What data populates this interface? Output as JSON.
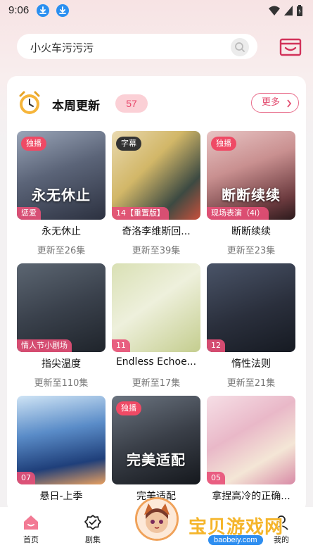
{
  "status_bar": {
    "time": "9:06"
  },
  "search": {
    "query": "小火车污污污"
  },
  "section": {
    "title": "本周更新",
    "count": "57",
    "more_label": "更多"
  },
  "items": [
    {
      "title": "永无休止",
      "update": "更新至26集",
      "top_tag": "独播",
      "bottom_tag": "惩爱",
      "cover_text": "永无休止"
    },
    {
      "title": "奇洛李维斯回...",
      "update": "更新至39集",
      "top_tag": "字幕",
      "bottom_tag": "14【重置版】",
      "cover_text": ""
    },
    {
      "title": "断断续续",
      "update": "更新至23集",
      "top_tag": "独播",
      "bottom_tag": "现场表演（4i）",
      "cover_text": "断断续续"
    },
    {
      "title": "指尖温度",
      "update": "更新至110集",
      "top_tag": "",
      "bottom_tag": "情人节小剧场",
      "cover_text": ""
    },
    {
      "title": "Endless Echoe...",
      "update": "更新至17集",
      "top_tag": "",
      "bottom_tag": "11",
      "cover_text": ""
    },
    {
      "title": "惰性法则",
      "update": "更新至21集",
      "top_tag": "",
      "bottom_tag": "12",
      "cover_text": ""
    },
    {
      "title": "悬日-上季",
      "update": "",
      "top_tag": "",
      "bottom_tag": "07",
      "cover_text": ""
    },
    {
      "title": "完美适配",
      "update": "",
      "top_tag": "独播",
      "bottom_tag": "",
      "cover_text": "完美适配"
    },
    {
      "title": "拿捏高冷的正确...",
      "update": "",
      "top_tag": "",
      "bottom_tag": "05",
      "cover_text": ""
    }
  ],
  "tabs": [
    {
      "label": "首页",
      "icon": "home-icon"
    },
    {
      "label": "剧集",
      "icon": "badge-check-icon"
    },
    {
      "label": "我的",
      "icon": "profile-icon"
    }
  ],
  "watermark": {
    "text": "宝贝游戏网",
    "url": "baobeiy.com"
  },
  "colors": {
    "accent": "#e8466a",
    "badge_bg": "#fbd0d6",
    "download_icon": "#2a8ff0"
  }
}
